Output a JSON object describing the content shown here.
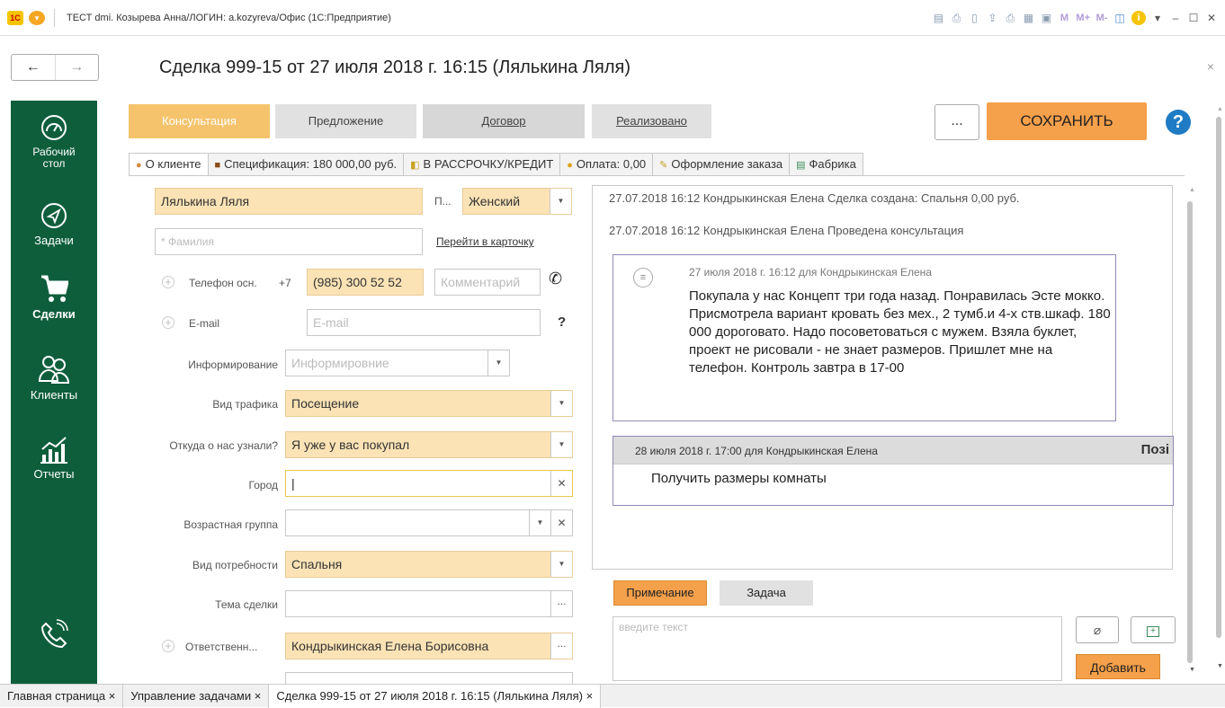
{
  "window": {
    "title": "ТЕСТ dmi. Козырева Анна/ЛОГИН: a.kozyreva/Офис  (1С:Предприятие)",
    "logo": "1С",
    "toolbar_icons": [
      "save-icon",
      "print-icon",
      "preview-icon",
      "upload-icon",
      "print2-icon",
      "calculator-icon",
      "calendar-icon"
    ],
    "memory_buttons": [
      "M",
      "M+",
      "M-"
    ]
  },
  "header": {
    "back_arrow": "←",
    "forward_arrow": "→",
    "doc_title": "Сделка 999-15 от 27 июля 2018 г. 16:15 (Лялькина Ляля)",
    "close": "×"
  },
  "sidebar": {
    "items": [
      {
        "label": "Рабочий стол",
        "line1": "Рабочий",
        "line2": "стол",
        "icon": "gauge-icon"
      },
      {
        "label": "Задачи",
        "icon": "paper-plane-icon"
      },
      {
        "label": "Сделки",
        "icon": "cart-icon",
        "active": true
      },
      {
        "label": "Клиенты",
        "icon": "users-icon"
      },
      {
        "label": "Отчеты",
        "icon": "chart-icon"
      }
    ],
    "phone_icon": "phone-icon"
  },
  "stages": [
    "Консультация",
    "Предложение",
    "Договор",
    "Реализовано"
  ],
  "actions": {
    "more": "...",
    "save": "СОХРАНИТЬ",
    "help": "?"
  },
  "tabs": [
    {
      "label": "О клиенте",
      "icon": "person-icon"
    },
    {
      "label": "Спецификация: 180 000,00 руб.",
      "icon": "book-icon"
    },
    {
      "label": "В РАССРОЧКУ/КРЕДИТ",
      "icon": "credit-icon"
    },
    {
      "label": "Оплата: 0,00",
      "icon": "coin-icon"
    },
    {
      "label": "Оформление заказа",
      "icon": "pencil-icon"
    },
    {
      "label": "Фабрика",
      "icon": "factory-icon"
    }
  ],
  "form": {
    "name": "Лялькина Ляля",
    "gender_label": "П...",
    "gender": "Женский",
    "surname_placeholder": "* Фамилия",
    "card_link": "Перейти в карточку",
    "phone_label": "Телефон осн.",
    "phone_prefix": "+7",
    "phone": "(985) 300 52 52",
    "comment_placeholder": "Комментарий",
    "email_label": "E-mail",
    "email_placeholder": "E-mail",
    "email_help": "?",
    "inform_label": "Информирование",
    "inform_placeholder": "Информировние",
    "traffic_label": "Вид трафика",
    "traffic": "Посещение",
    "source_label": "Откуда о нас узнали?",
    "source": "Я уже у вас покупал",
    "city_label": "Город",
    "city": "",
    "age_label": "Возрастная группа",
    "age": "",
    "need_label": "Вид потребности",
    "need": "Спальня",
    "topic_label": "Тема сделки",
    "topic": "",
    "resp_label": "Ответственн...",
    "resp": "Кондрыкинская Елена Борисовна"
  },
  "history": {
    "line1": "27.07.2018 16:12 Кондрыкинская Елена  Сделка создана: Спальня 0,00 руб.",
    "line2": "27.07.2018 16:12 Кондрыкинская Елена  Проведена консультация",
    "note_head": "27 июля 2018 г.  16:12 для Кондрыкинская Елена",
    "note_body": "Покупала у нас Концепт три года назад. Понравилась Эсте мокко. Присмотрела вариант кровать без мех., 2 тумб.и 4-х ств.шкаф. 180 000 дороговато. Надо посоветоваться с мужем.  Взяла буклет, проект не рисовали - не знает размеров. Пришлет мне на телефон.  Контроль завтра в 17-00",
    "task_head": "28 июля 2018 г.  17:00 для Кондрыкинская Елена",
    "task_status": "Позі",
    "task_body": "Получить размеры комнаты"
  },
  "compose": {
    "note_tab": "Примечание",
    "task_tab": "Задача",
    "placeholder": "введите текст",
    "add": "Добавить"
  },
  "taskbar": [
    {
      "label": "Главная страница ×"
    },
    {
      "label": "Управление задачами ×"
    },
    {
      "label": "Сделка 999-15 от 27 июля 2018 г. 16:15 (Лялькина Ляля) ×",
      "active": true
    }
  ]
}
